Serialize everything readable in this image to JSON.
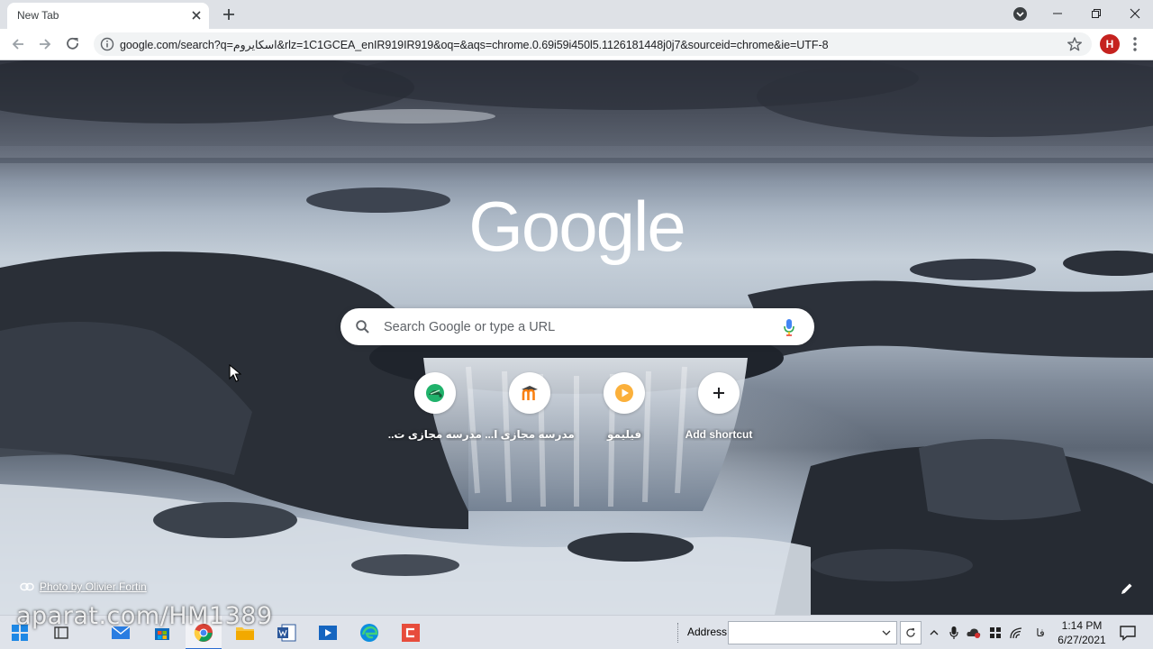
{
  "browser": {
    "tab_title": "New Tab",
    "url": "google.com/search?q=اسکایروم&rlz=1C1GCEA_enIR919IR919&oq=&aqs=chrome.0.69i59i450l5.1126181448j0j7&sourceid=chrome&ie=UTF-8",
    "profile_initial": "H",
    "profile_color": "#c5221f"
  },
  "ntp": {
    "logo_text": "Google",
    "search_placeholder": "Search Google or type a URL",
    "shortcuts": [
      {
        "label": "مدرسه مجازی ت...",
        "icon": "turtle-logo-icon"
      },
      {
        "label": "مدرسه مجازی ا...",
        "icon": "moodle-logo-icon"
      },
      {
        "label": "فیلیمو",
        "icon": "filimo-play-icon"
      },
      {
        "label": "Add shortcut",
        "icon": "plus-icon"
      }
    ],
    "photo_credit": "Photo by Olivier Fortin"
  },
  "taskbar": {
    "watermark": "aparat.com/HM1389",
    "address_label": "Address",
    "address_value": "",
    "language": "فا",
    "time": "1:14 PM",
    "date": "6/27/2021"
  }
}
